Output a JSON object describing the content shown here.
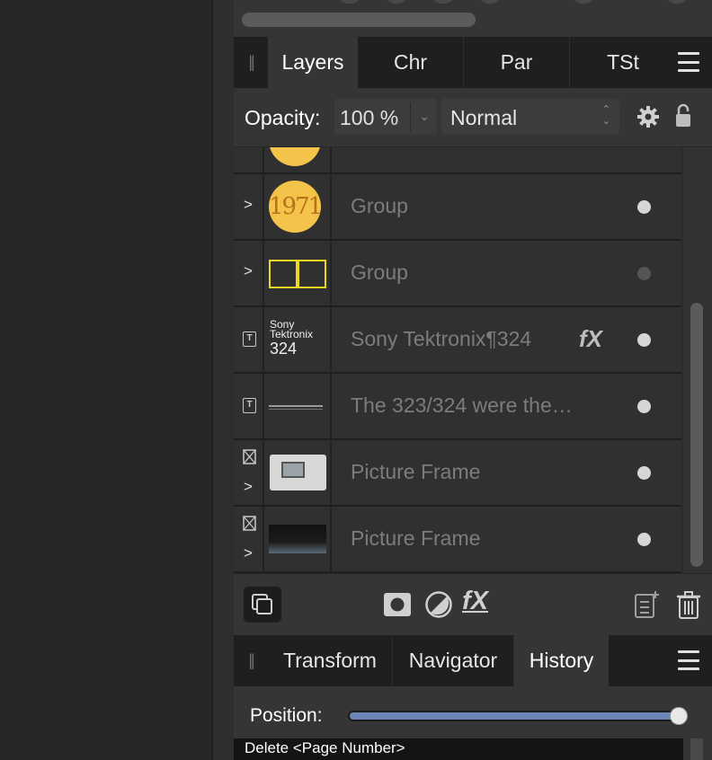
{
  "tabs": [
    "Layers",
    "Chr",
    "Par",
    "TSt"
  ],
  "opacity": {
    "label": "Opacity:",
    "value": "100 %",
    "blend_mode": "Normal"
  },
  "layers": [
    {
      "type": "group",
      "name": "Group",
      "thumb": "1971",
      "visible": true
    },
    {
      "type": "group",
      "name": "Group",
      "thumb": "yellow-rectangles",
      "visible": false
    },
    {
      "type": "text",
      "name": "Sony Tektronix¶324",
      "thumb_lines": [
        "Sony",
        "Tektronix",
        "324"
      ],
      "has_fx": true,
      "fx_label": "fX",
      "visible": true
    },
    {
      "type": "text",
      "name": "The 323/324 were the…",
      "thumb": "line",
      "visible": true
    },
    {
      "type": "picture-frame",
      "name": "Picture Frame",
      "thumb": "oscilloscope-photo",
      "visible": true
    },
    {
      "type": "picture-frame",
      "name": "Picture Frame",
      "thumb": "dark-gradient",
      "visible": true
    }
  ],
  "expander_glyph": ">",
  "text_icon_glyph": "T",
  "fx_tool_label": "fX",
  "bottom_tabs": [
    "Transform",
    "Navigator",
    "History"
  ],
  "history": {
    "position_label": "Position:",
    "position_fraction": 1.0,
    "items": [
      "Delete <Page Number>"
    ]
  },
  "colors": {
    "accent_slider": "#6d86b6",
    "badge_yellow": "#f4c34a",
    "thumb_outline": "#e8d820"
  }
}
